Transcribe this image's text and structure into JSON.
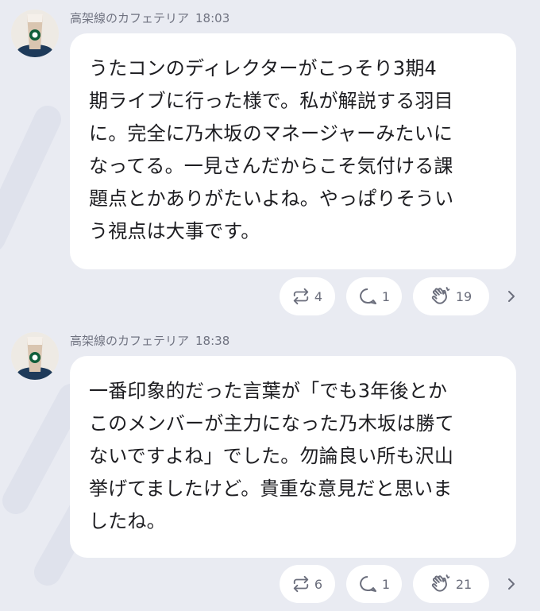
{
  "posts": [
    {
      "username": "高架線のカフェテリア",
      "time": "18:03",
      "lines": [
        "うたコンのディレクターがこっそり3期4",
        "期ライブに行った様で。私が解説する羽目",
        "に。完全に乃木坂のマネージャーみたいに",
        "なってる。一見さんだからこそ気付ける課",
        "題点とかありがたいよね。やっぱりそうい",
        "う視点は大事です。"
      ],
      "repost_count": "4",
      "reply_count": "1",
      "clap_count": "19"
    },
    {
      "username": "高架線のカフェテリア",
      "time": "18:38",
      "lines": [
        "一番印象的だった言葉が「でも3年後とか",
        "このメンバーが主力になった乃木坂は勝て",
        "ないですよね」でした。勿論良い所も沢山",
        "挙げてましたけど。貴重な意見だと思いま",
        "したね。"
      ],
      "repost_count": "6",
      "reply_count": "1",
      "clap_count": "21"
    }
  ],
  "colors": {
    "background": "#e9ebf2",
    "bubble": "#ffffff",
    "text": "#1d1d21",
    "meta": "#707381",
    "icon": "#6b6e7c"
  },
  "icons": {
    "repost": "repost-icon",
    "reply": "reply-icon",
    "clap": "clap-icon",
    "more": "chevron-right-icon",
    "avatar": "coffee-cup-avatar"
  }
}
